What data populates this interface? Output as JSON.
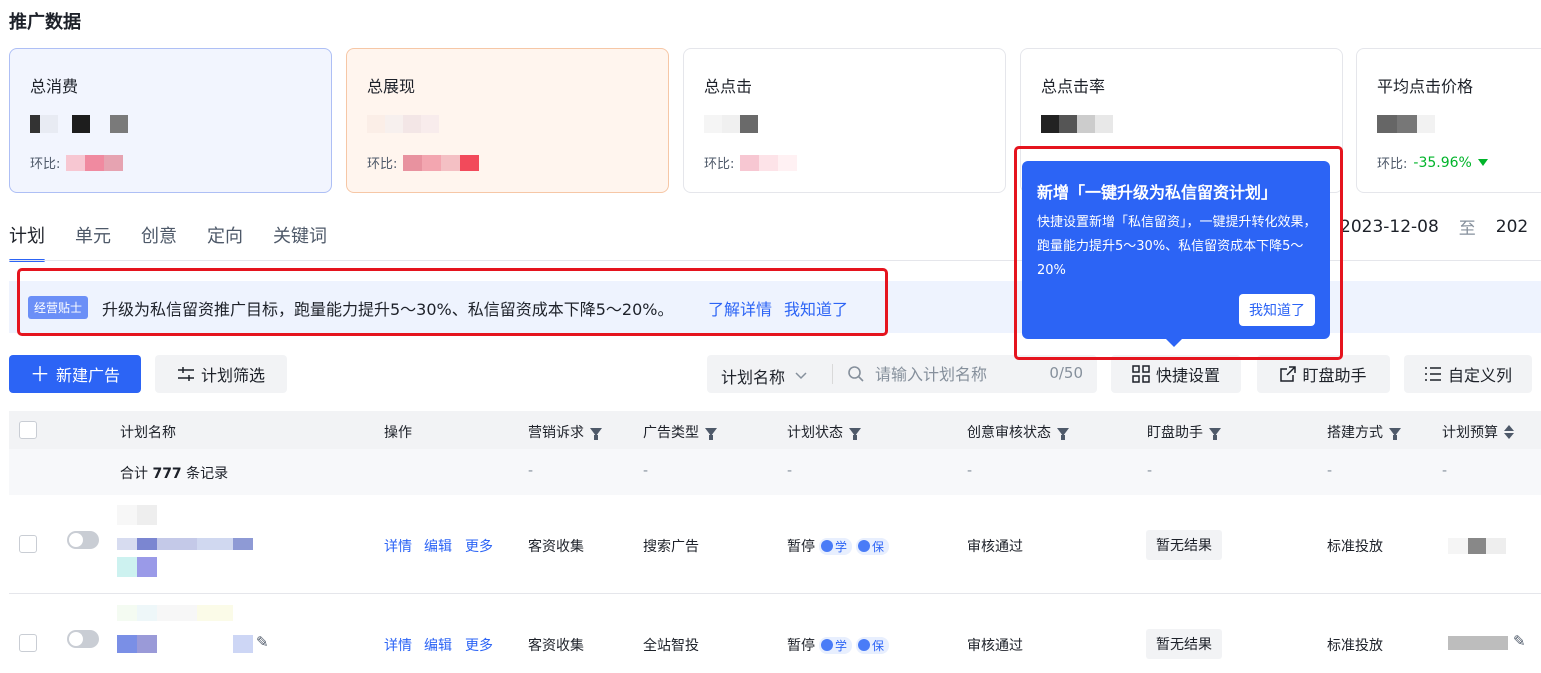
{
  "page_title": "推广数据",
  "cards": [
    {
      "label": "总消费",
      "ratio_label": "环比:",
      "ratio_value": ""
    },
    {
      "label": "总展现",
      "ratio_label": "环比:",
      "ratio_value": ""
    },
    {
      "label": "总点击",
      "ratio_label": "环比:",
      "ratio_value": ""
    },
    {
      "label": "总点击率",
      "ratio_label": "环比:",
      "ratio_value": ""
    },
    {
      "label": "平均点击价格",
      "ratio_label": "环比:",
      "ratio_value": "-35.96%"
    }
  ],
  "tabs": [
    "计划",
    "单元",
    "创意",
    "定向",
    "关键词"
  ],
  "date_range": {
    "start": "2023-12-08",
    "sep": "至",
    "end": "202"
  },
  "banner": {
    "badge": "经营贴士",
    "text": "升级为私信留资推广目标，跑量能力提升5～30%、私信留资成本下降5～20%。",
    "link_detail": "了解详情",
    "link_ack": "我知道了"
  },
  "popover": {
    "title": "新增「一键升级为私信留资计划」",
    "body": "快捷设置新增「私信留资」，一键提升转化效果，跑量能力提升5～30%、私信留资成本下降5～20%",
    "button": "我知道了"
  },
  "toolbar": {
    "new_ad": "新建广告",
    "plan_filter": "计划筛选",
    "search_select": "计划名称",
    "search_placeholder": "请输入计划名称",
    "search_count": "0/50",
    "quick_settings": "快捷设置",
    "monitor_helper": "盯盘助手",
    "custom_columns": "自定义列"
  },
  "table": {
    "headers": [
      "计划名称",
      "操作",
      "营销诉求",
      "广告类型",
      "计划状态",
      "创意审核状态",
      "盯盘助手",
      "搭建方式",
      "计划预算"
    ],
    "summary": {
      "prefix": "合计 ",
      "count": "777",
      "suffix": " 条记录",
      "dash": "-"
    },
    "rows": [
      {
        "ops": [
          "详情",
          "编辑",
          "更多"
        ],
        "goal": "客资收集",
        "type": "搜索广告",
        "status": "暂停",
        "tag1": "学",
        "tag2": "保",
        "review": "审核通过",
        "monitor": "暂无结果",
        "build": "标准投放"
      },
      {
        "ops": [
          "详情",
          "编辑",
          "更多"
        ],
        "goal": "客资收集",
        "type": "全站智投",
        "status": "暂停",
        "tag1": "学",
        "tag2": "保",
        "review": "审核通过",
        "monitor": "暂无结果",
        "build": "标准投放"
      }
    ]
  },
  "colors": {
    "accent": "#2c64f5",
    "highlight": "#e5141e",
    "positive": "#00b42a"
  }
}
